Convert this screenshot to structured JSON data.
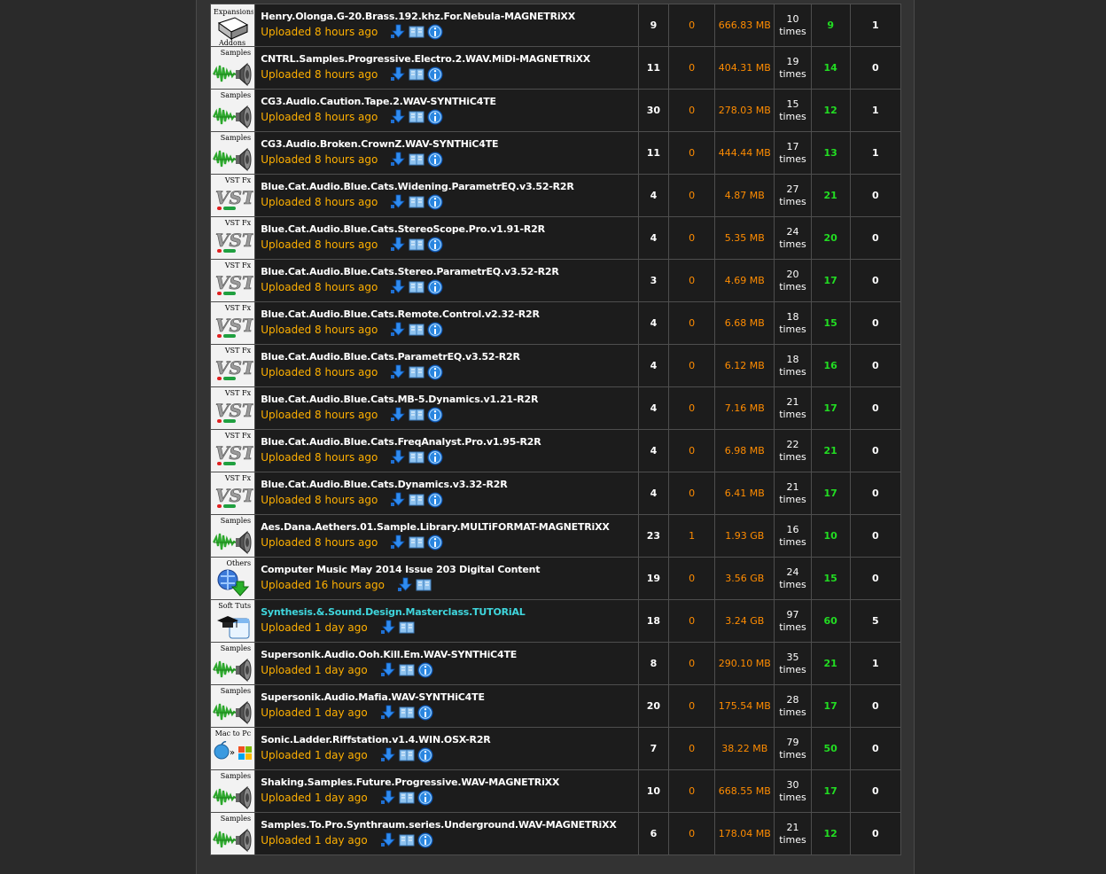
{
  "rows": [
    {
      "category": "Expansions Addons",
      "cat_type": "expansions",
      "name": "Henry.Olonga.G-20.Brass.192.khz.For.Nebula-MAGNETRiXX",
      "uploaded": "Uploaded 8 hours ago",
      "has_info": true,
      "highlight": false,
      "files": "9",
      "comments": "0",
      "size": "666.83 MB",
      "completed": "10",
      "completed_unit": "times",
      "seeders": "9",
      "leechers": "1"
    },
    {
      "category": "Samples",
      "cat_type": "samples",
      "name": "CNTRL.Samples.Progressive.Electro.2.WAV.MiDi-MAGNETRiXX",
      "uploaded": "Uploaded 8 hours ago",
      "has_info": true,
      "highlight": false,
      "files": "11",
      "comments": "0",
      "size": "404.31 MB",
      "completed": "19",
      "completed_unit": "times",
      "seeders": "14",
      "leechers": "0"
    },
    {
      "category": "Samples",
      "cat_type": "samples",
      "name": "CG3.Audio.Caution.Tape.2.WAV-SYNTHiC4TE",
      "uploaded": "Uploaded 8 hours ago",
      "has_info": true,
      "highlight": false,
      "files": "30",
      "comments": "0",
      "size": "278.03 MB",
      "completed": "15",
      "completed_unit": "times",
      "seeders": "12",
      "leechers": "1"
    },
    {
      "category": "Samples",
      "cat_type": "samples",
      "name": "CG3.Audio.Broken.CrownZ.WAV-SYNTHiC4TE",
      "uploaded": "Uploaded 8 hours ago",
      "has_info": true,
      "highlight": false,
      "files": "11",
      "comments": "0",
      "size": "444.44 MB",
      "completed": "17",
      "completed_unit": "times",
      "seeders": "13",
      "leechers": "1"
    },
    {
      "category": "VST Fx",
      "cat_type": "vst",
      "name": "Blue.Cat.Audio.Blue.Cats.Widening.ParametrEQ.v3.52-R2R",
      "uploaded": "Uploaded 8 hours ago",
      "has_info": true,
      "highlight": false,
      "files": "4",
      "comments": "0",
      "size": "4.87 MB",
      "completed": "27",
      "completed_unit": "times",
      "seeders": "21",
      "leechers": "0"
    },
    {
      "category": "VST Fx",
      "cat_type": "vst",
      "name": "Blue.Cat.Audio.Blue.Cats.StereoScope.Pro.v1.91-R2R",
      "uploaded": "Uploaded 8 hours ago",
      "has_info": true,
      "highlight": false,
      "files": "4",
      "comments": "0",
      "size": "5.35 MB",
      "completed": "24",
      "completed_unit": "times",
      "seeders": "20",
      "leechers": "0"
    },
    {
      "category": "VST Fx",
      "cat_type": "vst",
      "name": "Blue.Cat.Audio.Blue.Cats.Stereo.ParametrEQ.v3.52-R2R",
      "uploaded": "Uploaded 8 hours ago",
      "has_info": true,
      "highlight": false,
      "files": "3",
      "comments": "0",
      "size": "4.69 MB",
      "completed": "20",
      "completed_unit": "times",
      "seeders": "17",
      "leechers": "0"
    },
    {
      "category": "VST Fx",
      "cat_type": "vst",
      "name": "Blue.Cat.Audio.Blue.Cats.Remote.Control.v2.32-R2R",
      "uploaded": "Uploaded 8 hours ago",
      "has_info": true,
      "highlight": false,
      "files": "4",
      "comments": "0",
      "size": "6.68 MB",
      "completed": "18",
      "completed_unit": "times",
      "seeders": "15",
      "leechers": "0"
    },
    {
      "category": "VST Fx",
      "cat_type": "vst",
      "name": "Blue.Cat.Audio.Blue.Cats.ParametrEQ.v3.52-R2R",
      "uploaded": "Uploaded 8 hours ago",
      "has_info": true,
      "highlight": false,
      "files": "4",
      "comments": "0",
      "size": "6.12 MB",
      "completed": "18",
      "completed_unit": "times",
      "seeders": "16",
      "leechers": "0"
    },
    {
      "category": "VST Fx",
      "cat_type": "vst",
      "name": "Blue.Cat.Audio.Blue.Cats.MB-5.Dynamics.v1.21-R2R",
      "uploaded": "Uploaded 8 hours ago",
      "has_info": true,
      "highlight": false,
      "files": "4",
      "comments": "0",
      "size": "7.16 MB",
      "completed": "21",
      "completed_unit": "times",
      "seeders": "17",
      "leechers": "0"
    },
    {
      "category": "VST Fx",
      "cat_type": "vst",
      "name": "Blue.Cat.Audio.Blue.Cats.FreqAnalyst.Pro.v1.95-R2R",
      "uploaded": "Uploaded 8 hours ago",
      "has_info": true,
      "highlight": false,
      "files": "4",
      "comments": "0",
      "size": "6.98 MB",
      "completed": "22",
      "completed_unit": "times",
      "seeders": "21",
      "leechers": "0"
    },
    {
      "category": "VST Fx",
      "cat_type": "vst",
      "name": "Blue.Cat.Audio.Blue.Cats.Dynamics.v3.32-R2R",
      "uploaded": "Uploaded 8 hours ago",
      "has_info": true,
      "highlight": false,
      "files": "4",
      "comments": "0",
      "size": "6.41 MB",
      "completed": "21",
      "completed_unit": "times",
      "seeders": "17",
      "leechers": "0"
    },
    {
      "category": "Samples",
      "cat_type": "samples",
      "name": "Aes.Dana.Aethers.01.Sample.Library.MULTiFORMAT-MAGNETRiXX",
      "uploaded": "Uploaded 8 hours ago",
      "has_info": true,
      "highlight": false,
      "files": "23",
      "comments": "1",
      "size": "1.93 GB",
      "completed": "16",
      "completed_unit": "times",
      "seeders": "10",
      "leechers": "0"
    },
    {
      "category": "Others",
      "cat_type": "others",
      "name": "Computer Music May 2014 Issue 203 Digital Content",
      "uploaded": "Uploaded 16 hours ago",
      "has_info": false,
      "highlight": false,
      "files": "19",
      "comments": "0",
      "size": "3.56 GB",
      "completed": "24",
      "completed_unit": "times",
      "seeders": "15",
      "leechers": "0"
    },
    {
      "category": "Soft Tuts",
      "cat_type": "tuts",
      "name": "Synthesis.&.Sound.Design.Masterclass.TUTORiAL",
      "uploaded": "Uploaded 1 day ago",
      "has_info": false,
      "highlight": true,
      "files": "18",
      "comments": "0",
      "size": "3.24 GB",
      "completed": "97",
      "completed_unit": "times",
      "seeders": "60",
      "leechers": "5"
    },
    {
      "category": "Samples",
      "cat_type": "samples",
      "name": "Supersonik.Audio.Ooh.Kill.Em.WAV-SYNTHiC4TE",
      "uploaded": "Uploaded 1 day ago",
      "has_info": true,
      "highlight": false,
      "files": "8",
      "comments": "0",
      "size": "290.10 MB",
      "completed": "35",
      "completed_unit": "times",
      "seeders": "21",
      "leechers": "1"
    },
    {
      "category": "Samples",
      "cat_type": "samples",
      "name": "Supersonik.Audio.Mafia.WAV-SYNTHiC4TE",
      "uploaded": "Uploaded 1 day ago",
      "has_info": true,
      "highlight": false,
      "files": "20",
      "comments": "0",
      "size": "175.54 MB",
      "completed": "28",
      "completed_unit": "times",
      "seeders": "17",
      "leechers": "0"
    },
    {
      "category": "Mac to Pc",
      "cat_type": "mac",
      "name": "Sonic.Ladder.Riffstation.v1.4.WIN.OSX-R2R",
      "uploaded": "Uploaded 1 day ago",
      "has_info": true,
      "highlight": false,
      "files": "7",
      "comments": "0",
      "size": "38.22 MB",
      "completed": "79",
      "completed_unit": "times",
      "seeders": "50",
      "leechers": "0"
    },
    {
      "category": "Samples",
      "cat_type": "samples",
      "name": "Shaking.Samples.Future.Progressive.WAV-MAGNETRiXX",
      "uploaded": "Uploaded 1 day ago",
      "has_info": true,
      "highlight": false,
      "files": "10",
      "comments": "0",
      "size": "668.55 MB",
      "completed": "30",
      "completed_unit": "times",
      "seeders": "17",
      "leechers": "0"
    },
    {
      "category": "Samples",
      "cat_type": "samples",
      "name": "Samples.To.Pro.Synthraum.series.Underground.WAV-MAGNETRiXX",
      "uploaded": "Uploaded 1 day ago",
      "has_info": true,
      "highlight": false,
      "files": "6",
      "comments": "0",
      "size": "178.04 MB",
      "completed": "21",
      "completed_unit": "times",
      "seeders": "12",
      "leechers": "0"
    }
  ]
}
